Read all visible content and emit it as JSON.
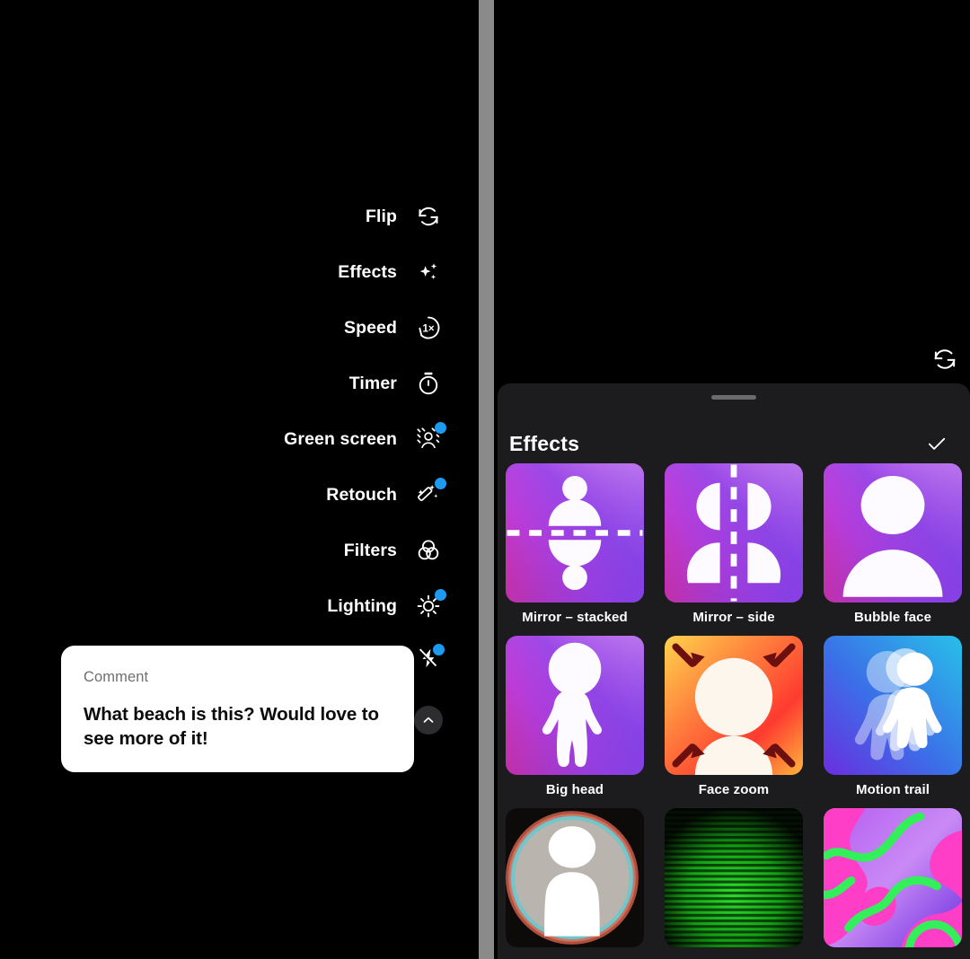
{
  "colors": {
    "app_background": "#000000",
    "sheet_background": "#1c1c1e",
    "badge_blue": "#1d9bf0",
    "scrollbar_gray": "#8a8a8a",
    "card_white": "#ffffff",
    "comment_kicker_gray": "#6e6e73"
  },
  "camera_menu": {
    "items": [
      {
        "label": "Flip",
        "icon": "flip-camera-icon",
        "badge": false
      },
      {
        "label": "Effects",
        "icon": "sparkles-icon",
        "badge": false
      },
      {
        "label": "Speed",
        "icon": "speed-1x-icon",
        "badge": false
      },
      {
        "label": "Timer",
        "icon": "timer-icon",
        "badge": false
      },
      {
        "label": "Green screen",
        "icon": "green-screen-icon",
        "badge": true
      },
      {
        "label": "Retouch",
        "icon": "magic-wand-icon",
        "badge": true
      },
      {
        "label": "Filters",
        "icon": "filters-icon",
        "badge": false
      },
      {
        "label": "Lighting",
        "icon": "lighting-sun-icon",
        "badge": true
      }
    ],
    "flash_button": {
      "icon": "flash-off-icon",
      "badge": true
    },
    "scroll_down_button": {
      "icon": "chevron-up-icon"
    }
  },
  "comment_card": {
    "kicker": "Comment",
    "body": "What beach is this? Would love to see more of it!"
  },
  "right_pane": {
    "flip_button_icon": "flip-camera-icon"
  },
  "effects_sheet": {
    "title": "Effects",
    "confirm_icon": "checkmark-icon",
    "grabber": "sheet-drag-handle",
    "effects": [
      {
        "label": "Mirror – stacked",
        "thumb": "mirror-stacked-thumb"
      },
      {
        "label": "Mirror – side",
        "thumb": "mirror-side-thumb"
      },
      {
        "label": "Bubble face",
        "thumb": "bubble-face-thumb"
      },
      {
        "label": "Big head",
        "thumb": "big-head-thumb"
      },
      {
        "label": "Face zoom",
        "thumb": "face-zoom-thumb"
      },
      {
        "label": "Motion trail",
        "thumb": "motion-trail-thumb"
      },
      {
        "label": "",
        "thumb": "spotlight-thumb"
      },
      {
        "label": "",
        "thumb": "green-scanlines-thumb"
      },
      {
        "label": "",
        "thumb": "psychedelic-thumb"
      }
    ]
  }
}
